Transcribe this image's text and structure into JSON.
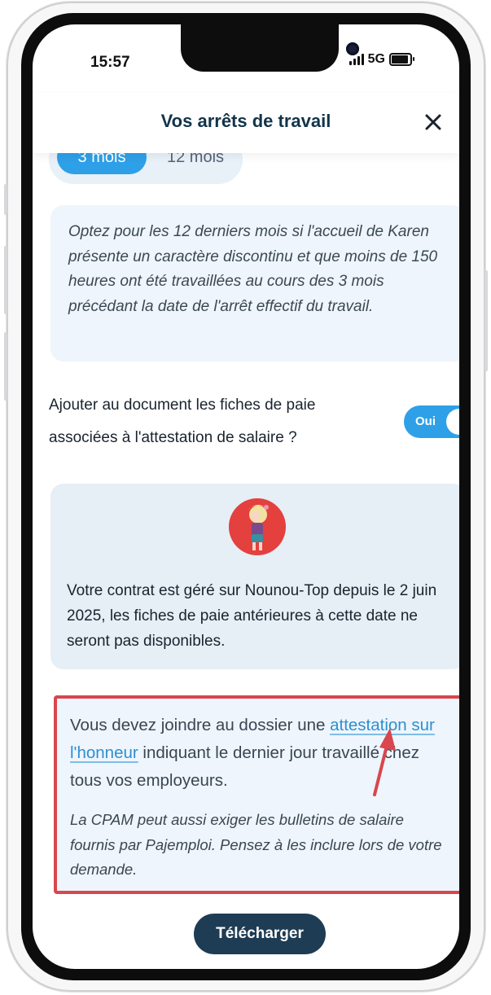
{
  "status_bar": {
    "time": "15:57",
    "network": "5G"
  },
  "header": {
    "title": "Vos arrêts de travail"
  },
  "period_selector": {
    "options": [
      "3 mois",
      "12 mois"
    ],
    "selected": "3 mois"
  },
  "info_box": {
    "text": "Optez pour les 12 derniers mois si l'accueil de Karen présente un caractère discontinu et que moins de 150 heures ont été travaillées au cours des 3 mois précédant la date de l'arrêt effectif du travail."
  },
  "payslip_option": {
    "label": "Ajouter au document les fiches de paie associées à l'attestation de salaire ?",
    "toggle_label": "Oui",
    "value": true
  },
  "contract_notice": {
    "text": "Votre contrat est géré sur Nounou-Top depuis le 2 juin 2025, les fiches de paie antérieures à cette date ne seront pas disponibles."
  },
  "documents_notice": {
    "text_before": "Vous devez joindre au dossier une ",
    "link": "attestation sur l'honneur",
    "text_after": " indiquant le dernier jour travaillé chez tous vos employeurs.",
    "note": "La CPAM peut aussi exiger les bulletins de salaire fournis par Pajemploi. Pensez à les inclure lors de votre demande."
  },
  "actions": {
    "download_label": "Télécharger"
  },
  "colors": {
    "accent": "#2ea0e8",
    "dark": "#1e3c54",
    "highlight": "#d9464d"
  }
}
